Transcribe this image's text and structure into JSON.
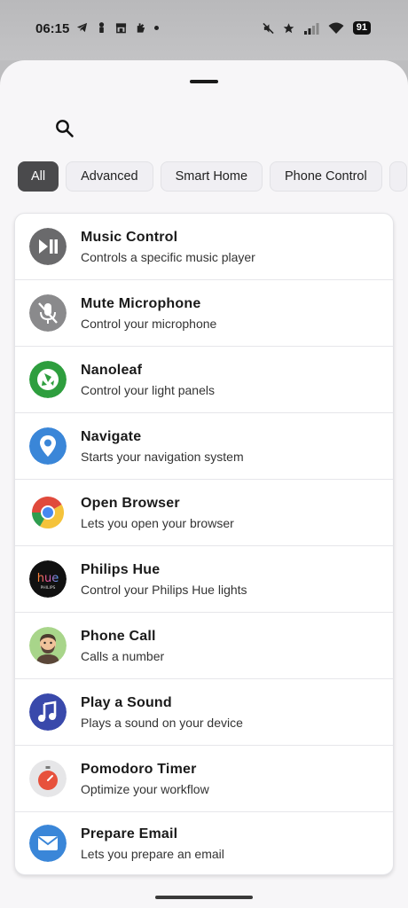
{
  "status_bar": {
    "time": "06:15",
    "battery": "91",
    "left_icons": [
      "telegram-icon",
      "person-icon",
      "store-icon",
      "hand-icon"
    ],
    "right_icons": [
      "mute-icon",
      "star-icon",
      "signal-icon",
      "wifi-icon"
    ]
  },
  "filters": [
    {
      "label": "All",
      "active": true
    },
    {
      "label": "Advanced",
      "active": false
    },
    {
      "label": "Smart Home",
      "active": false
    },
    {
      "label": "Phone Control",
      "active": false
    }
  ],
  "items": [
    {
      "title": "Music Control",
      "subtitle": "Controls a specific music player",
      "icon": "play-pause-icon"
    },
    {
      "title": "Mute Microphone",
      "subtitle": "Control your microphone",
      "icon": "mic-off-icon"
    },
    {
      "title": "Nanoleaf",
      "subtitle": "Control your light panels",
      "icon": "nanoleaf-icon"
    },
    {
      "title": "Navigate",
      "subtitle": "Starts your navigation system",
      "icon": "location-pin-icon"
    },
    {
      "title": "Open Browser",
      "subtitle": "Lets you open your browser",
      "icon": "chrome-icon"
    },
    {
      "title": "Philips Hue",
      "subtitle": "Control your Philips Hue lights",
      "icon": "philips-hue-icon"
    },
    {
      "title": "Phone Call",
      "subtitle": "Calls a number",
      "icon": "contact-avatar-icon"
    },
    {
      "title": "Play a Sound",
      "subtitle": "Plays a sound on your device",
      "icon": "music-note-icon"
    },
    {
      "title": "Pomodoro Timer",
      "subtitle": "Optimize your workflow",
      "icon": "timer-icon"
    },
    {
      "title": "Prepare Email",
      "subtitle": "Lets you prepare an email",
      "icon": "mail-icon"
    }
  ],
  "hue_logo": {
    "word": "hue",
    "brand": "PHILIPS"
  }
}
